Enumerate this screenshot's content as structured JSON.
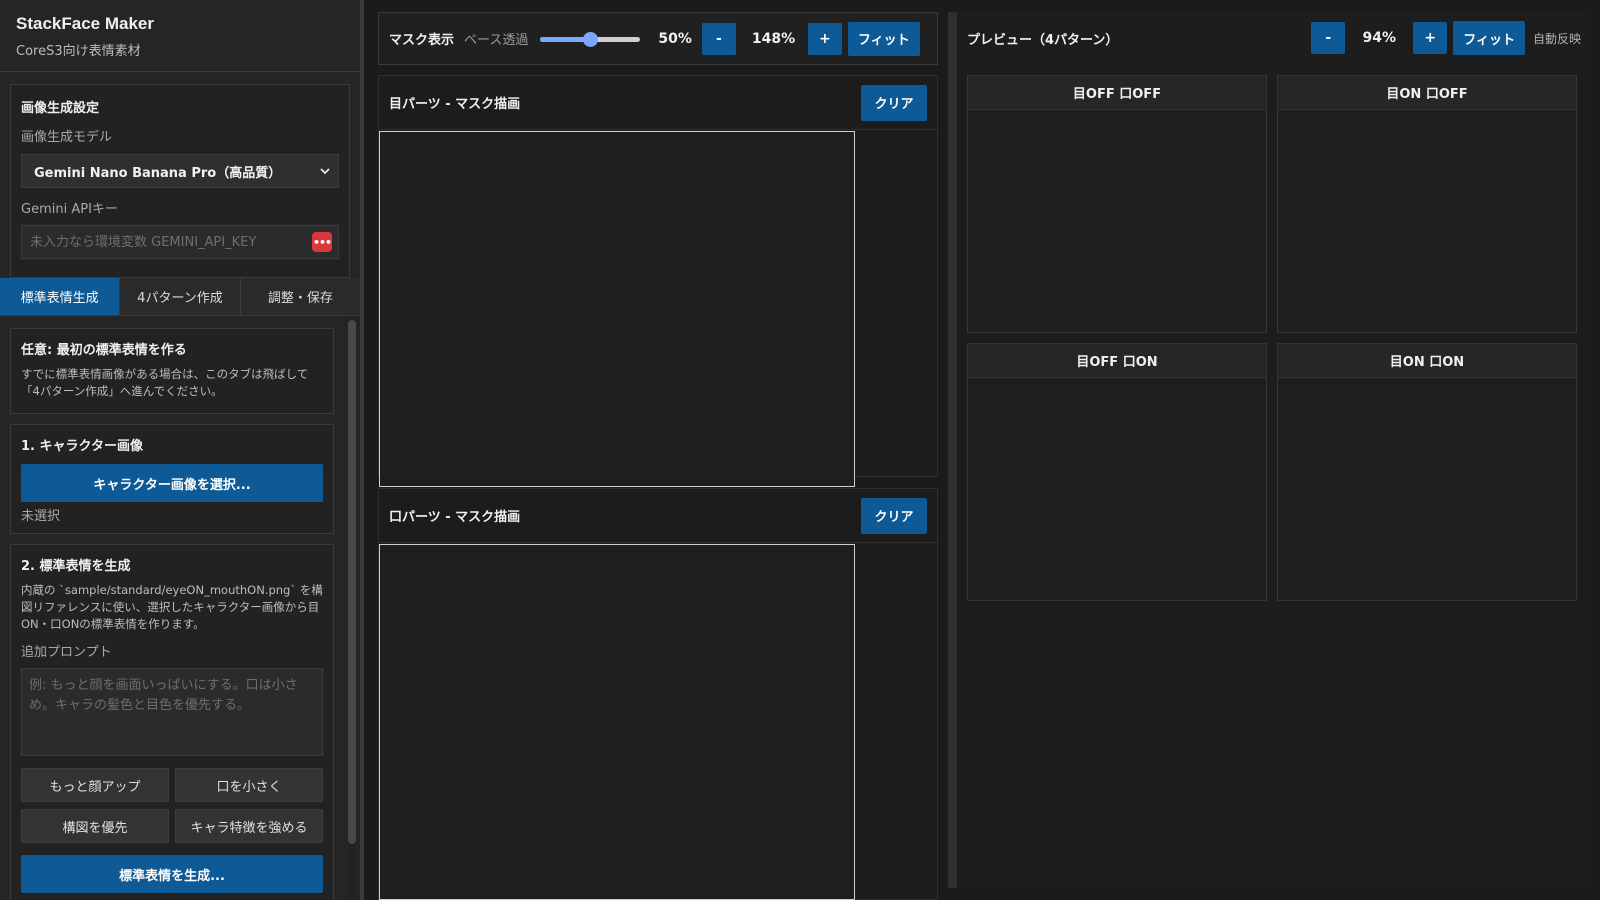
{
  "app": {
    "title": "StackFace Maker",
    "subtitle": "CoreS3向け表情素材"
  },
  "settings": {
    "title": "画像生成設定",
    "model_label": "画像生成モデル",
    "model_value": "Gemini Nano Banana Pro（高品質）",
    "apikey_label": "Gemini APIキー",
    "apikey_placeholder": "未入力なら環境変数 GEMINI_API_KEY",
    "password_icon_text": "•••"
  },
  "tabs": [
    {
      "label": "標準表情生成",
      "active": true
    },
    {
      "label": "4パターン作成",
      "active": false
    },
    {
      "label": "調整・保存",
      "active": false
    }
  ],
  "tab_standard": {
    "optional": {
      "title": "任意: 最初の標準表情を作る",
      "desc": "すでに標準表情画像がある場合は、このタブは飛ばして「4パターン作成」へ進んでください。"
    },
    "character": {
      "title": "1. キャラクター画像",
      "button": "キャラクター画像を選択...",
      "status": "未選択"
    },
    "generate": {
      "title": "2. 標準表情を生成",
      "desc": "内蔵の `sample/standard/eyeON_mouthON.png` を構図リファレンスに使い、選択したキャラクター画像から目ON・口ONの標準表情を作ります。",
      "prompt_label": "追加プロンプト",
      "prompt_placeholder": "例: もっと顔を画面いっぱいにする。口は小さめ。キャラの髪色と目色を優先する。",
      "chips": [
        "もっと顔アップ",
        "口を小さく",
        "構図を優先",
        "キャラ特徴を強める"
      ],
      "button": "標準表情を生成..."
    }
  },
  "mask_toolbar": {
    "title": "マスク表示",
    "opacity_label": "ベース透過",
    "opacity_value": 0.5,
    "opacity_text": "50%",
    "zoom_minus": "-",
    "zoom_text": "148%",
    "zoom_plus": "+",
    "fit": "フィット"
  },
  "eye_panel": {
    "title": "目パーツ - マスク描画",
    "clear": "クリア"
  },
  "mouth_panel": {
    "title": "口パーツ - マスク描画",
    "clear": "クリア"
  },
  "preview": {
    "title": "プレビュー（4パターン）",
    "zoom_minus": "-",
    "zoom_text": "94%",
    "zoom_plus": "+",
    "fit": "フィット",
    "auto": "自動反映",
    "patterns": [
      "目OFF 口OFF",
      "目ON 口OFF",
      "目OFF 口ON",
      "目ON 口ON"
    ]
  },
  "colors": {
    "accent": "#0e5a96",
    "slider": "#7aa7ff",
    "danger": "#d9363e"
  }
}
